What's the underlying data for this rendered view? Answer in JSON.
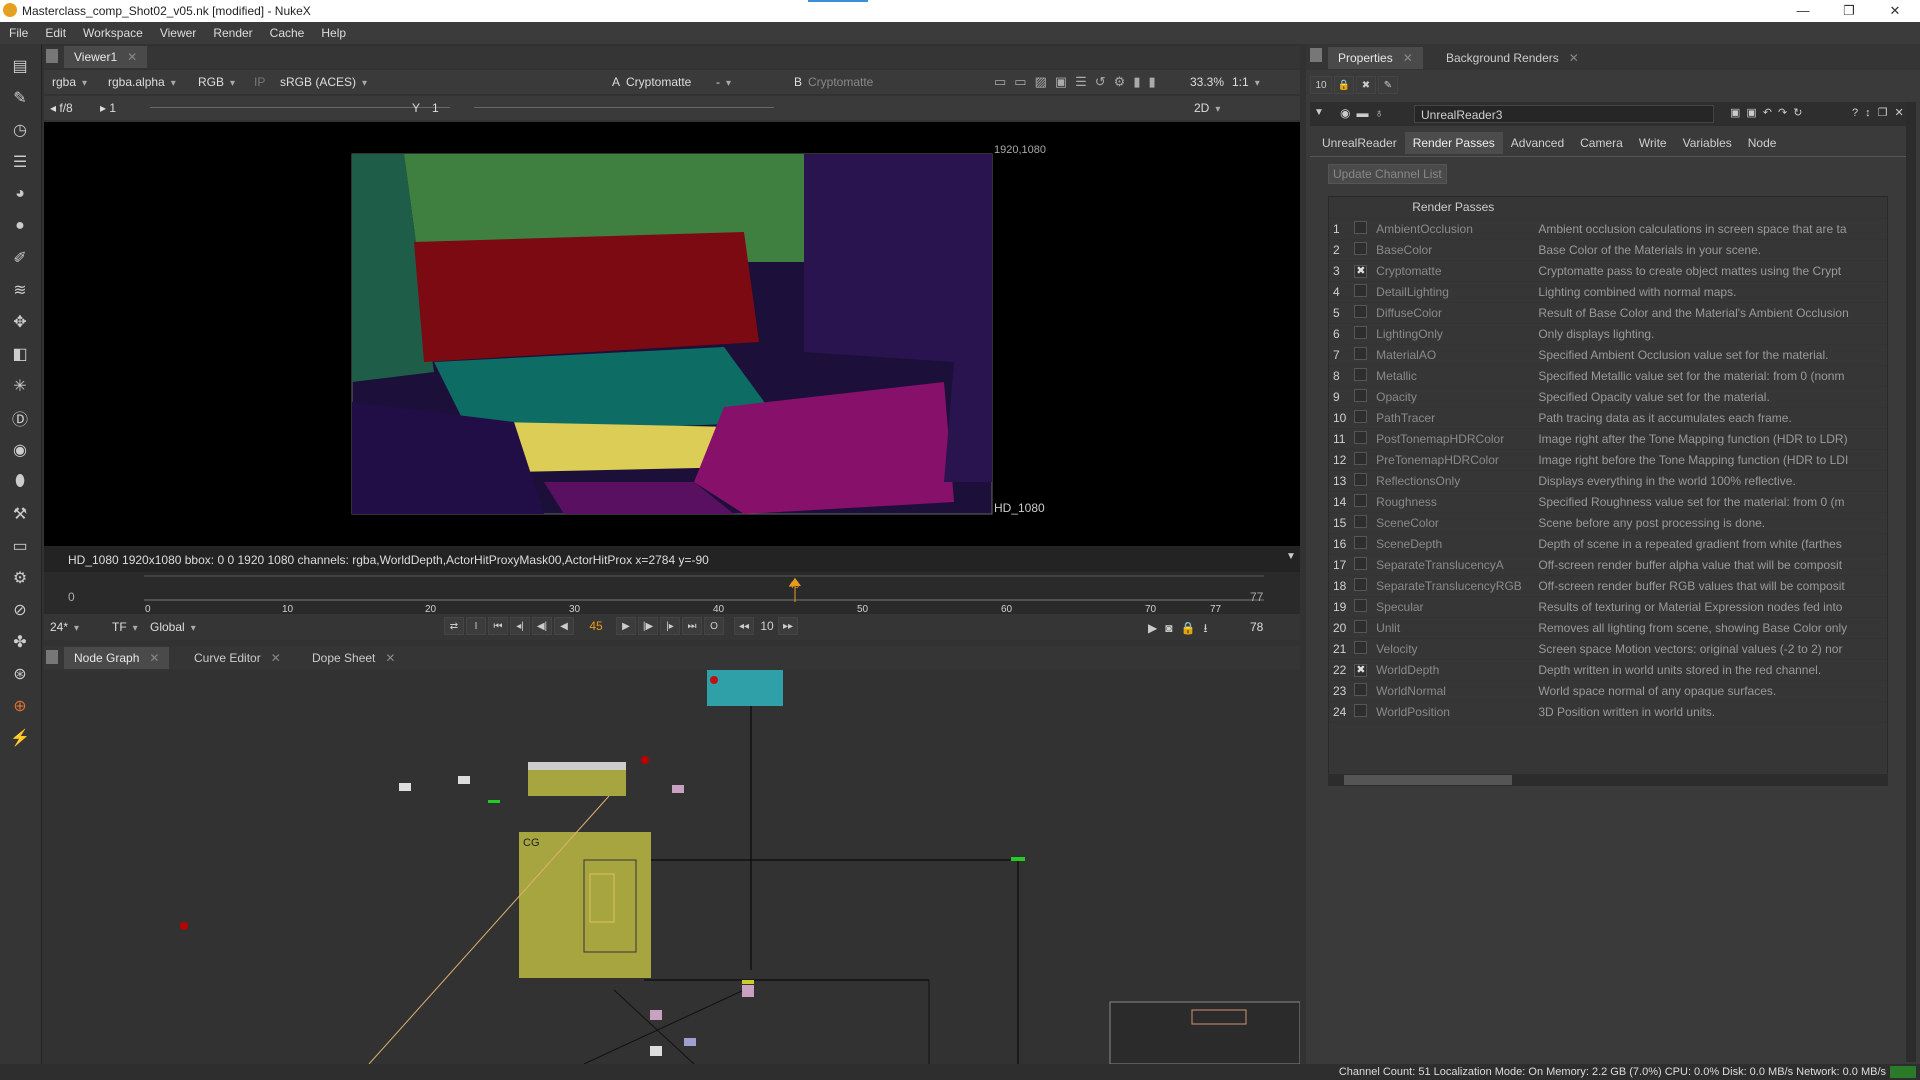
{
  "window": {
    "title": "Masterclass_comp_Shot02_v05.nk [modified] - NukeX"
  },
  "menu": [
    "File",
    "Edit",
    "Workspace",
    "Viewer",
    "Render",
    "Cache",
    "Help"
  ],
  "toolbar_icons": [
    "image-icon",
    "draw-icon",
    "time-icon",
    "channel-icon",
    "color-icon",
    "filter-icon",
    "keyer-icon",
    "merge-icon",
    "transform-icon",
    "3d-icon",
    "particles-icon",
    "deep-icon",
    "views-icon",
    "metadata-icon",
    "toolsets-icon",
    "other-icon",
    "furnace-icon",
    "ocula-icon",
    "cara-icon",
    "plugin-icon",
    "cryptomatte-icon",
    "unreal-icon"
  ],
  "viewer": {
    "tab": "Viewer1",
    "channels": "rgba",
    "layer": "rgba.alpha",
    "display": "RGB",
    "ip": "IP",
    "colorspace": "sRGB (ACES)",
    "input_a_label": "A",
    "input_a": "Cryptomatte",
    "input_a_blend": "-",
    "input_b_label": "B",
    "input_b": "Cryptomatte",
    "zoom": "33.3%",
    "ratio": "1:1",
    "fstop": "f/8",
    "frame_step": "1",
    "y_label": "Y",
    "y_value": "1",
    "mode": "2D",
    "format_top": "1920,1080",
    "format_bottom": "HD_1080",
    "info": "HD_1080 1920x1080  bbox: 0 0 1920 1080 channels: rgba,WorldDepth,ActorHitProxyMask00,ActorHitProx  x=2784 y=-90"
  },
  "timeline": {
    "start": "0",
    "end": "77",
    "ticks": [
      "0",
      "10",
      "20",
      "30",
      "40",
      "50",
      "60",
      "70",
      "77"
    ],
    "current": "45",
    "current_marker": "45",
    "fps": "24*",
    "tf": "TF",
    "scope": "Global",
    "step": "10",
    "end_frame": "78",
    "in_label": "I",
    "out_label": "O"
  },
  "node_tabs": [
    "Node Graph",
    "Curve Editor",
    "Dope Sheet"
  ],
  "node_graph": {
    "backdrop_label": "CG"
  },
  "props": {
    "tabs": [
      "Properties",
      "Background Renders"
    ],
    "max_panels": "10",
    "node_name": "UnrealReader3",
    "node_tabs": [
      "UnrealReader",
      "Render Passes",
      "Advanced",
      "Camera",
      "Write",
      "Variables",
      "Node"
    ],
    "update_button": "Update Channel List",
    "table_header": "Render Passes",
    "passes": [
      {
        "n": "1",
        "name": "AmbientOcclusion",
        "desc": "Ambient occlusion calculations in screen space that are ta",
        "checked": ""
      },
      {
        "n": "2",
        "name": "BaseColor",
        "desc": "Base Color of the Materials in your scene.",
        "checked": ""
      },
      {
        "n": "3",
        "name": "Cryptomatte",
        "desc": "Cryptomatte pass to create object mattes using the Crypt",
        "checked": "✖"
      },
      {
        "n": "4",
        "name": "DetailLighting",
        "desc": "Lighting combined with normal maps.",
        "checked": ""
      },
      {
        "n": "5",
        "name": "DiffuseColor",
        "desc": "Result of Base Color and the Material's Ambient Occlusion",
        "checked": ""
      },
      {
        "n": "6",
        "name": "LightingOnly",
        "desc": "Only displays lighting.",
        "checked": ""
      },
      {
        "n": "7",
        "name": "MaterialAO",
        "desc": "Specified Ambient Occlusion value set for the material.",
        "checked": ""
      },
      {
        "n": "8",
        "name": "Metallic",
        "desc": "Specified Metallic value set for the material: from 0 (nonm",
        "checked": ""
      },
      {
        "n": "9",
        "name": "Opacity",
        "desc": "Specified Opacity value set for the material.",
        "checked": ""
      },
      {
        "n": "10",
        "name": "PathTracer",
        "desc": "Path tracing data as it accumulates each frame.",
        "checked": ""
      },
      {
        "n": "11",
        "name": "PostTonemapHDRColor",
        "desc": "Image right after the Tone Mapping function (HDR to LDR)",
        "checked": ""
      },
      {
        "n": "12",
        "name": "PreTonemapHDRColor",
        "desc": "Image right before the Tone Mapping function (HDR to LDI",
        "checked": ""
      },
      {
        "n": "13",
        "name": "ReflectionsOnly",
        "desc": "Displays everything in the world 100% reflective.",
        "checked": ""
      },
      {
        "n": "14",
        "name": "Roughness",
        "desc": "Specified Roughness value set for the material: from 0 (m",
        "checked": ""
      },
      {
        "n": "15",
        "name": "SceneColor",
        "desc": "Scene before any post processing is done.",
        "checked": ""
      },
      {
        "n": "16",
        "name": "SceneDepth",
        "desc": "Depth of scene in a repeated gradient from white (farthes",
        "checked": ""
      },
      {
        "n": "17",
        "name": "SeparateTranslucencyA",
        "desc": "Off-screen render buffer alpha value that will be composit",
        "checked": ""
      },
      {
        "n": "18",
        "name": "SeparateTranslucencyRGB",
        "desc": "Off-screen render buffer RGB values that will be composit",
        "checked": ""
      },
      {
        "n": "19",
        "name": "Specular",
        "desc": "Results of texturing or Material Expression nodes fed into",
        "checked": ""
      },
      {
        "n": "20",
        "name": "Unlit",
        "desc": "Removes all lighting from scene, showing Base Color only",
        "checked": ""
      },
      {
        "n": "21",
        "name": "Velocity",
        "desc": "Screen space Motion vectors: original values (-2 to 2) nor",
        "checked": ""
      },
      {
        "n": "22",
        "name": "WorldDepth",
        "desc": "Depth written in world units stored in the red channel.",
        "checked": "✖"
      },
      {
        "n": "23",
        "name": "WorldNormal",
        "desc": "World space normal of any opaque surfaces.",
        "checked": ""
      },
      {
        "n": "24",
        "name": "WorldPosition",
        "desc": "3D Position written in world units.",
        "checked": ""
      }
    ]
  },
  "status": "Channel Count: 51 Localization Mode: On Memory: 2.2 GB (7.0%) CPU: 0.0% Disk: 0.0 MB/s Network: 0.0 MB/s"
}
